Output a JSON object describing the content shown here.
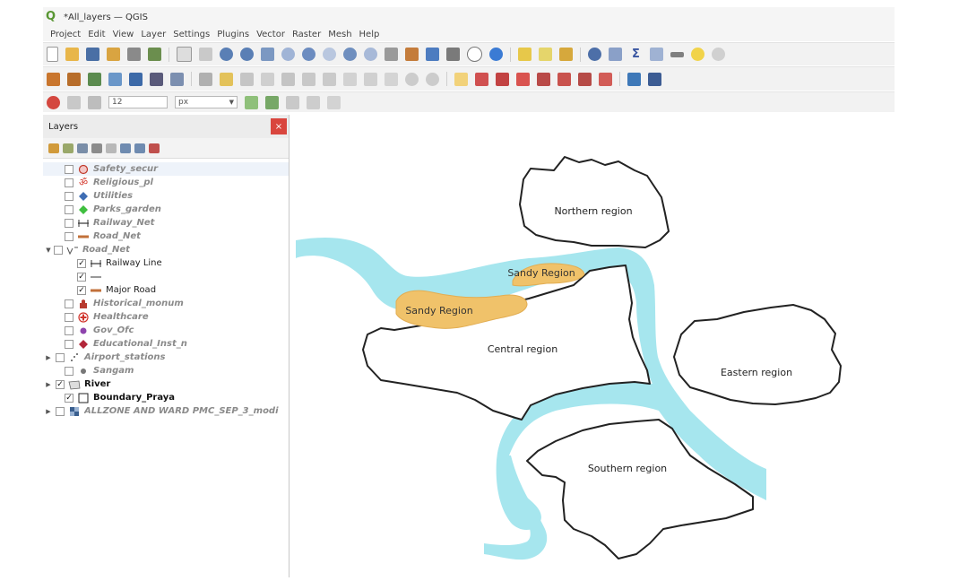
{
  "window": {
    "title": "*All_layers — QGIS"
  },
  "menu": [
    "Project",
    "Edit",
    "View",
    "Layer",
    "Settings",
    "Plugins",
    "Vector",
    "Raster",
    "Mesh",
    "Help"
  ],
  "digitizing": {
    "size_value": "12",
    "unit": "px"
  },
  "layers_panel": {
    "title": "Layers",
    "close_symbol": "×",
    "layers": [
      {
        "name": "Safety_secur",
        "checked": false,
        "icon": "circle-outline-icon",
        "selected": true
      },
      {
        "name": "Religious_pl",
        "checked": false,
        "icon": "om-icon"
      },
      {
        "name": "Utilities",
        "checked": false,
        "icon": "blue-diamond-icon"
      },
      {
        "name": "Parks_garden",
        "checked": false,
        "icon": "green-diamond-icon"
      },
      {
        "name": "Railway_Net",
        "checked": false,
        "icon": "railway-line-icon"
      },
      {
        "name": "Road_Net",
        "checked": false,
        "icon": "road-line-icon"
      },
      {
        "name": "Road_Net",
        "checked": false,
        "icon": "rule-based-line-icon",
        "expanded": true
      },
      {
        "name": "Railway Line",
        "checked": true,
        "icon": "railway-line-icon",
        "child": true
      },
      {
        "name": "",
        "checked": true,
        "icon": "thin-line-icon",
        "child": true
      },
      {
        "name": "Major Road",
        "checked": true,
        "icon": "road-line-icon",
        "child": true
      },
      {
        "name": "Historical_monum",
        "checked": false,
        "icon": "monument-icon"
      },
      {
        "name": "Healthcare",
        "checked": false,
        "icon": "healthcare-cross-icon"
      },
      {
        "name": "Gov_Ofc",
        "checked": false,
        "icon": "purple-dot-icon"
      },
      {
        "name": "Educational_Inst_n",
        "checked": false,
        "icon": "red-diamond-icon"
      },
      {
        "name": "Airport_stations",
        "checked": false,
        "icon": "point-cluster-icon",
        "collapsed": true
      },
      {
        "name": "Sangam",
        "checked": false,
        "icon": "grey-dot-icon"
      },
      {
        "name": "River",
        "checked": true,
        "icon": "river-polygon-icon",
        "collapsed": true
      },
      {
        "name": "Boundary_Praya",
        "checked": true,
        "icon": "boundary-square-icon"
      },
      {
        "name": "ALLZONE AND WARD PMC_SEP_3_modi",
        "checked": false,
        "icon": "raster-icon",
        "collapsed": true
      }
    ]
  },
  "map": {
    "regions": [
      {
        "name": "Northern region"
      },
      {
        "name": "Central region"
      },
      {
        "name": "Eastern region"
      },
      {
        "name": "Southern region"
      }
    ],
    "sandy": [
      "Sandy Region",
      "Sandy Region"
    ],
    "colors": {
      "river": "#a6e6ee",
      "sandy": "#f0c26a",
      "boundary": "#222222",
      "fill": "#ffffff"
    }
  }
}
